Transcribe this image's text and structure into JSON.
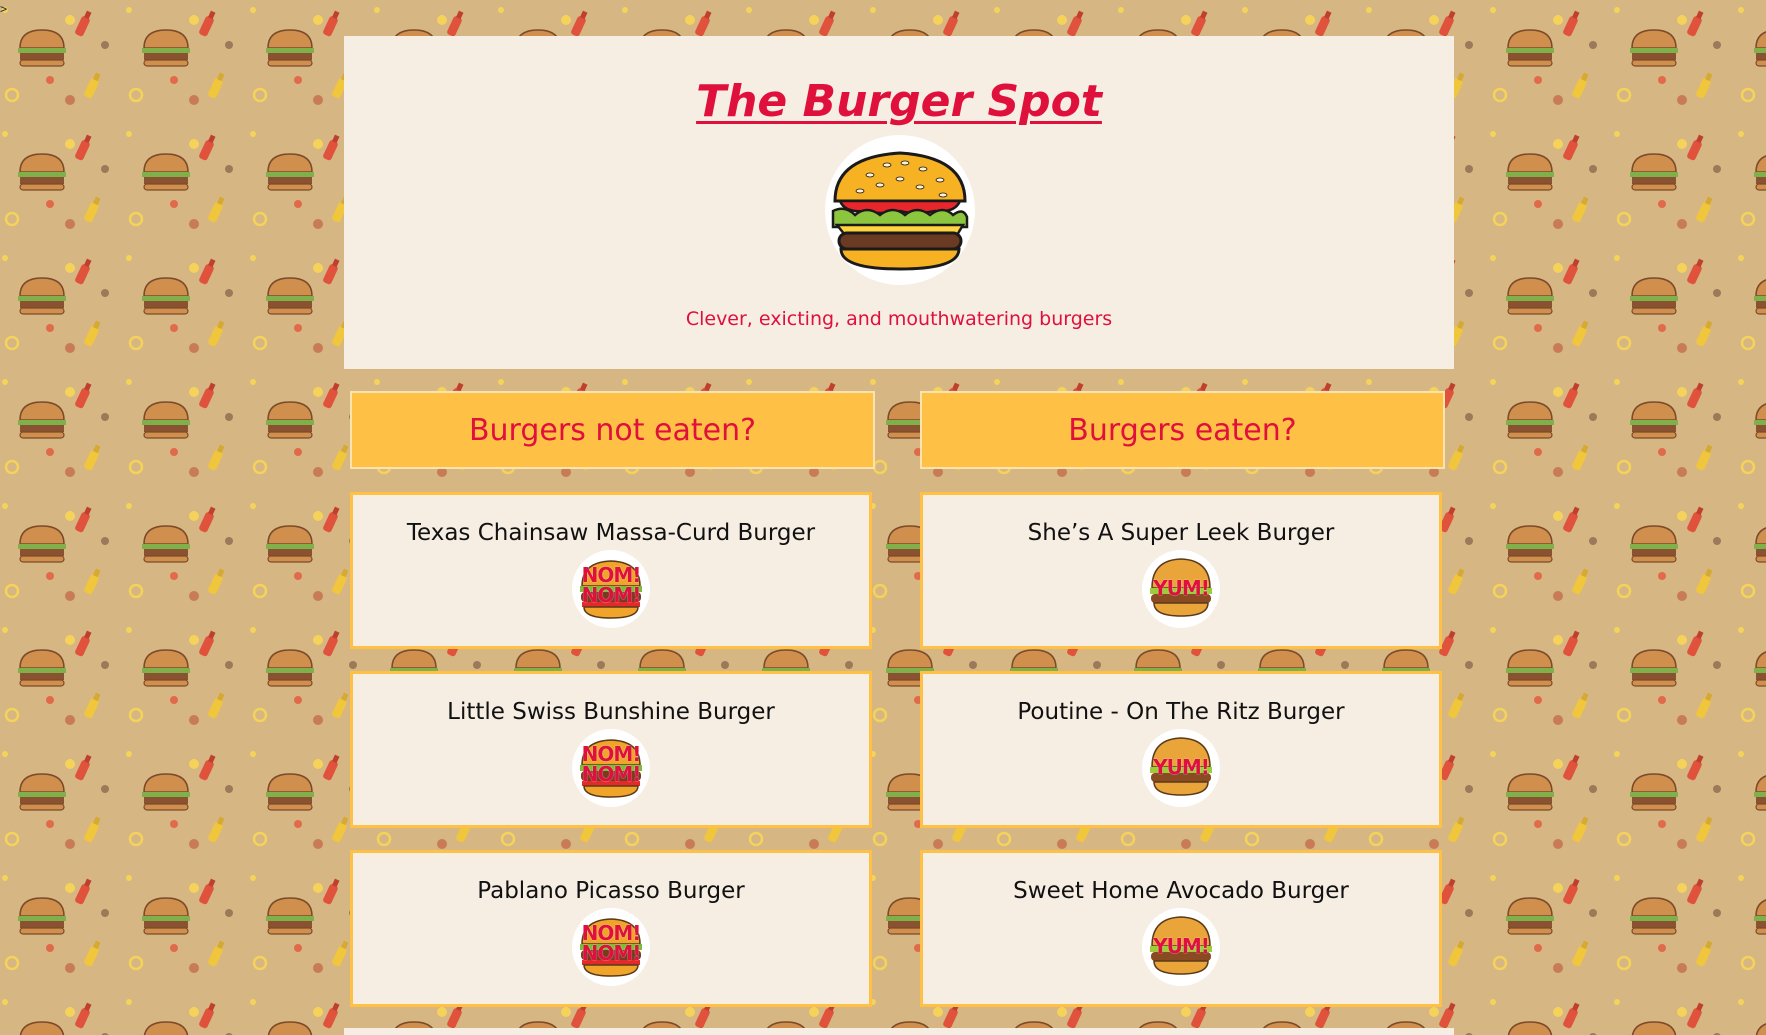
{
  "site": {
    "title": "The Burger Spot",
    "tagline": "Clever, exicting, and mouthwatering burgers"
  },
  "columns": {
    "not_eaten_label": "Burgers not eaten?",
    "eaten_label": "Burgers eaten?"
  },
  "not_eaten": [
    {
      "name": "Texas Chainsaw Massa-Curd Burger",
      "stamp": "NOM! NOM!"
    },
    {
      "name": "Little Swiss Bunshine Burger",
      "stamp": "NOM! NOM!"
    },
    {
      "name": "Pablano Picasso Burger",
      "stamp": "NOM! NOM!"
    }
  ],
  "eaten": [
    {
      "name": "She’s A Super Leek Burger",
      "stamp": "YUM!"
    },
    {
      "name": "Poutine - On The Ritz Burger",
      "stamp": "YUM!"
    },
    {
      "name": "Sweet Home Avocado Burger",
      "stamp": "YUM!"
    }
  ],
  "colors": {
    "accent": "#e0103c",
    "button": "#ffc145",
    "panel": "#f6ede3",
    "background": "#d6b683"
  },
  "icons": [
    "burger-logo-icon",
    "burger-thumbnail-icon"
  ]
}
